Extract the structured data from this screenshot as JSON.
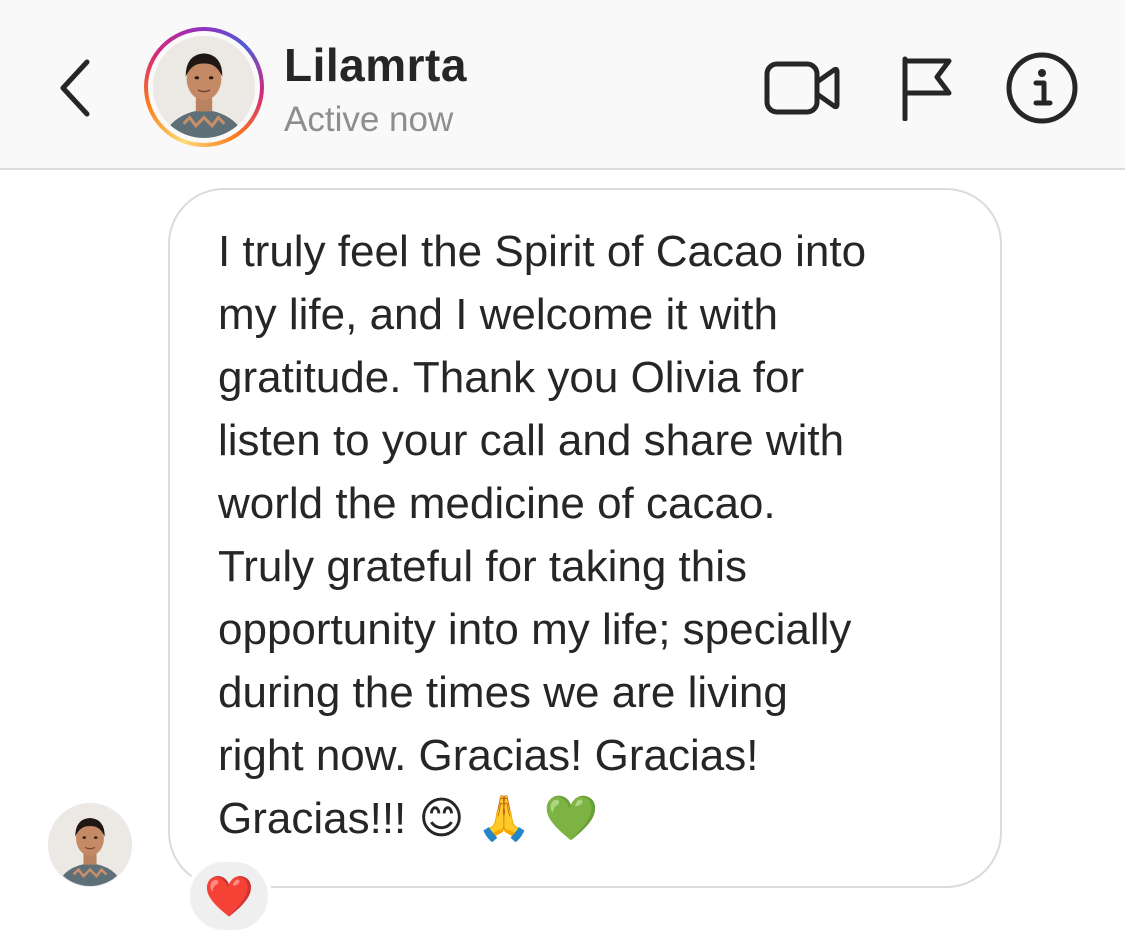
{
  "header": {
    "username": "Lilamrta",
    "status": "Active now",
    "icons": {
      "back": "chevron-left-icon",
      "video": "video-camera-icon",
      "flag": "flag-icon",
      "info": "info-icon"
    }
  },
  "thread": {
    "message": "I truly feel the Spirit of Cacao into\nmy life, and I welcome it with\ngratitude. Thank you Olivia for\nlisten to your call and share with\nworld the medicine of cacao.\nTruly grateful for taking this\nopportunity into my life; specially\nduring the times we are living\nright now. Gracias! Gracias!\nGracias!!! 😊 🙏 💚",
    "reaction": "❤️"
  },
  "colors": {
    "header_bg": "#f9f9f9",
    "text": "#262626",
    "muted": "#8e8e8e",
    "border": "#dbdbdb",
    "reaction_bg": "#efefef",
    "heart": "#e0245e"
  }
}
